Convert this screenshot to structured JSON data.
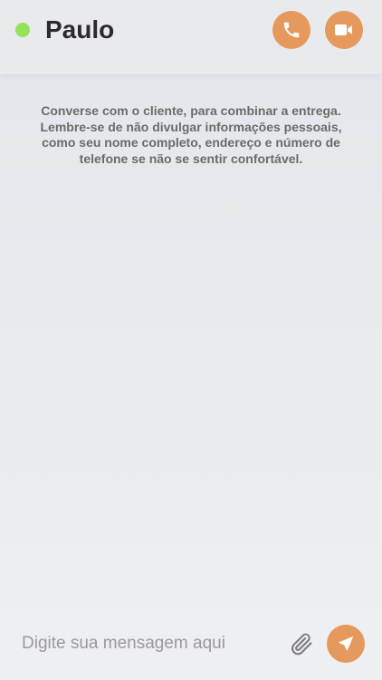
{
  "header": {
    "contact_name": "Paulo",
    "online_status_color": "#94e25a",
    "actions": [
      {
        "name": "phone-call-button",
        "icon": "phone-icon"
      },
      {
        "name": "video-call-button",
        "icon": "video-camera-icon"
      }
    ]
  },
  "chat": {
    "notice": "Converse com o cliente, para combinar a entrega. Lembre-se de não divulgar informações pessoais, como seu nome completo, endereço e número de telefone se não se sentir confortável."
  },
  "composer": {
    "placeholder": "Digite sua mensagem aqui",
    "value": "",
    "attach_icon": "paperclip-icon",
    "send_icon": "send-arrow-icon"
  },
  "colors": {
    "accent": "#e6995c",
    "text_dark": "#2b2b2b",
    "notice_text": "#6b6b6b",
    "placeholder": "#9a9a9a"
  }
}
